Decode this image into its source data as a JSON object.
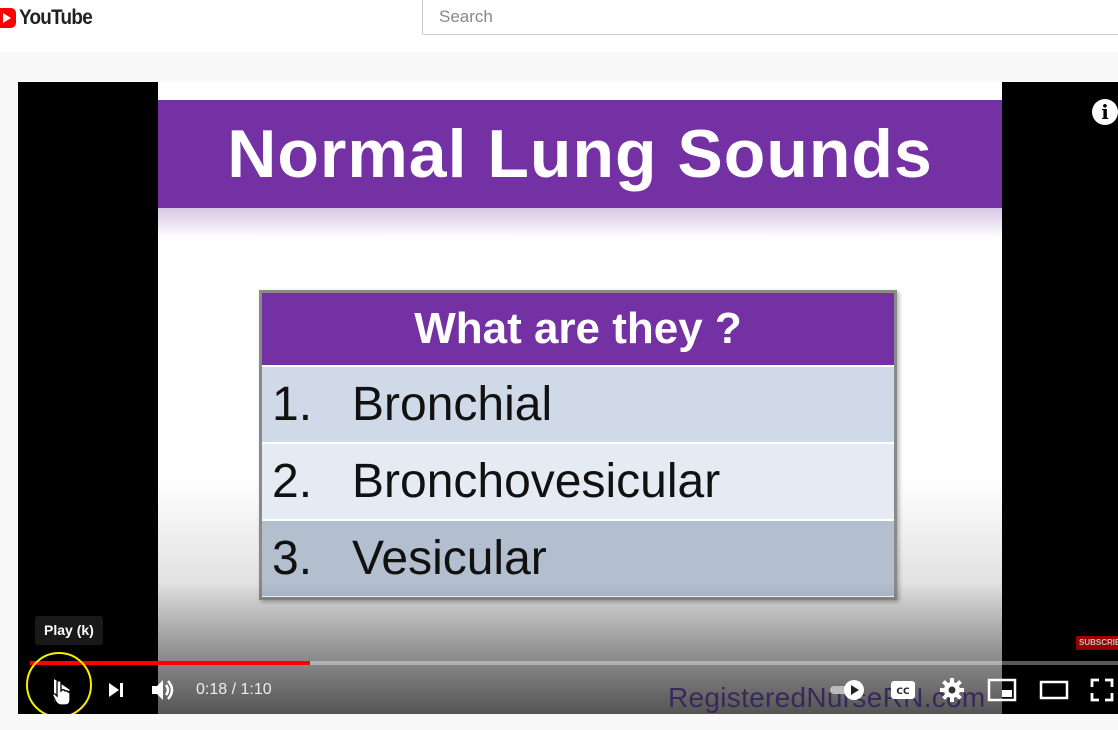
{
  "header": {
    "logo_text": "YouTube",
    "search_placeholder": "Search"
  },
  "slide": {
    "title": "Normal Lung Sounds",
    "card_heading": "What are they ?",
    "items": [
      {
        "num": "1.",
        "label": "Bronchial"
      },
      {
        "num": "2.",
        "label": "Bronchovesicular"
      },
      {
        "num": "3.",
        "label": "Vesicular"
      }
    ],
    "watermark": "RegisteredNurseRN.com",
    "subscribe_label": "SUBSCRIBE"
  },
  "player": {
    "tooltip": "Play (k)",
    "current_time": "0:18",
    "duration": "1:10",
    "time_separator": " / ",
    "progress_fraction": 0.257,
    "accent_color": "#ff0000",
    "slide_purple": "#7331a3",
    "cursor_highlight_color": "#f4f000"
  }
}
